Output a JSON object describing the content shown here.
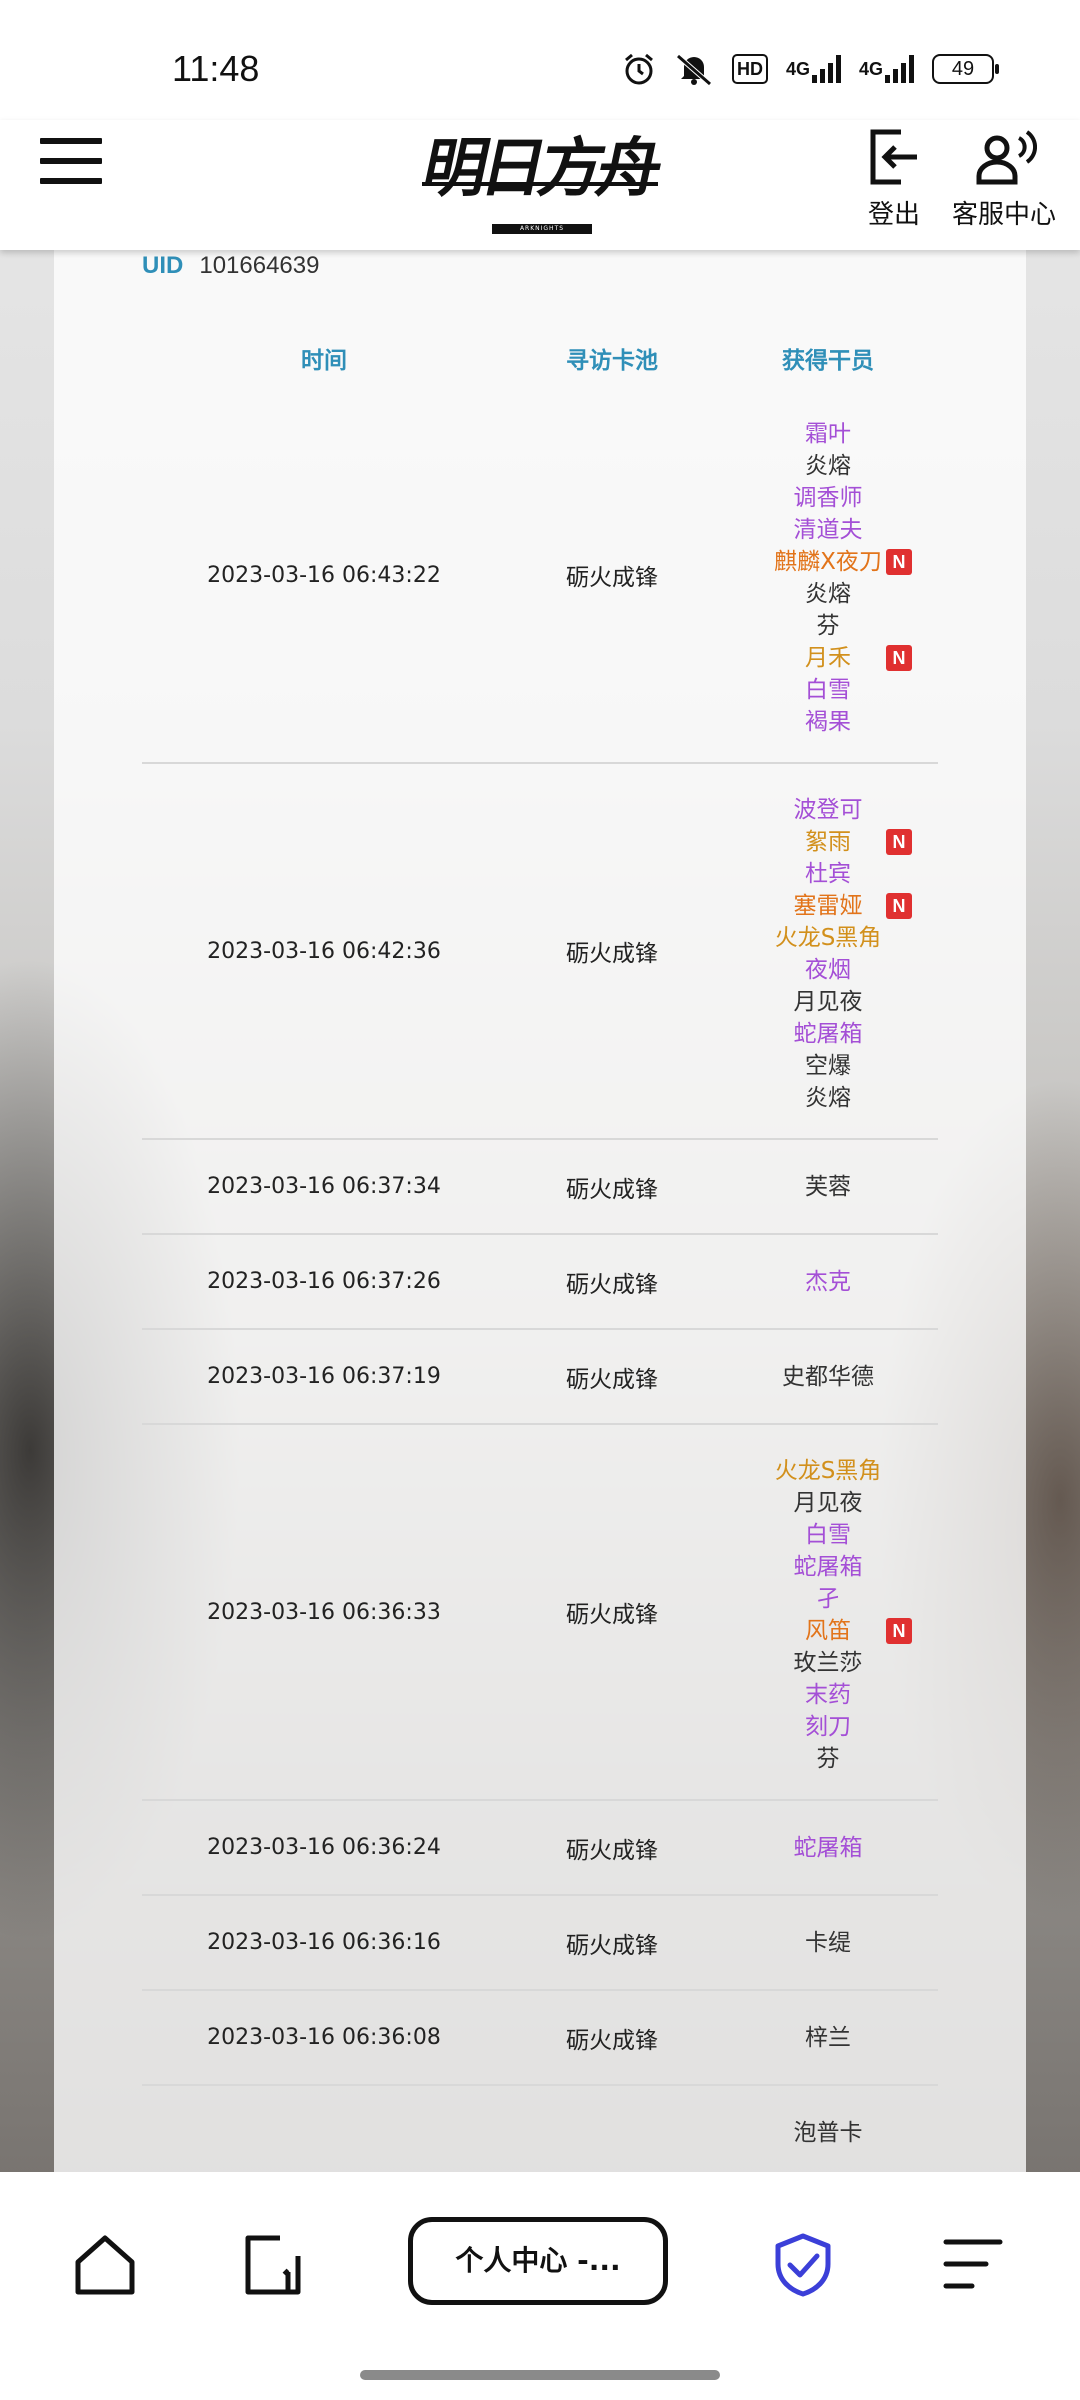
{
  "status": {
    "time": "11:48",
    "hd": "HD",
    "sig1": "4G",
    "sig2": "4G",
    "battery": "49"
  },
  "header": {
    "logo": "明日方舟",
    "logo_sub": "ARKNIGHTS",
    "logout_label": "登出",
    "service_label": "客服中心"
  },
  "uid": {
    "label": "UID",
    "value": "101664639"
  },
  "table": {
    "headers": [
      "时间",
      "寻访卡池",
      "获得干员"
    ],
    "rows": [
      {
        "time": "2023-03-16 06:43:22",
        "pool": "砺火成锋",
        "ops": [
          {
            "name": "霜叶",
            "rarity": 4,
            "new": false
          },
          {
            "name": "炎熔",
            "rarity": 3,
            "new": false
          },
          {
            "name": "调香师",
            "rarity": 4,
            "new": false
          },
          {
            "name": "清道夫",
            "rarity": 4,
            "new": false
          },
          {
            "name": "麒麟X夜刀",
            "rarity": 6,
            "new": true
          },
          {
            "name": "炎熔",
            "rarity": 3,
            "new": false
          },
          {
            "name": "芬",
            "rarity": 3,
            "new": false
          },
          {
            "name": "月禾",
            "rarity": 5,
            "new": true
          },
          {
            "name": "白雪",
            "rarity": 4,
            "new": false
          },
          {
            "name": "褐果",
            "rarity": 4,
            "new": false
          }
        ]
      },
      {
        "time": "2023-03-16 06:42:36",
        "pool": "砺火成锋",
        "ops": [
          {
            "name": "波登可",
            "rarity": 4,
            "new": false
          },
          {
            "name": "絮雨",
            "rarity": 5,
            "new": true
          },
          {
            "name": "杜宾",
            "rarity": 4,
            "new": false
          },
          {
            "name": "塞雷娅",
            "rarity": 6,
            "new": true
          },
          {
            "name": "火龙S黑角",
            "rarity": 5,
            "new": false
          },
          {
            "name": "夜烟",
            "rarity": 4,
            "new": false
          },
          {
            "name": "月见夜",
            "rarity": 3,
            "new": false
          },
          {
            "name": "蛇屠箱",
            "rarity": 4,
            "new": false
          },
          {
            "name": "空爆",
            "rarity": 3,
            "new": false
          },
          {
            "name": "炎熔",
            "rarity": 3,
            "new": false
          }
        ]
      },
      {
        "time": "2023-03-16 06:37:34",
        "pool": "砺火成锋",
        "ops": [
          {
            "name": "芙蓉",
            "rarity": 3,
            "new": false
          }
        ]
      },
      {
        "time": "2023-03-16 06:37:26",
        "pool": "砺火成锋",
        "ops": [
          {
            "name": "杰克",
            "rarity": 4,
            "new": false
          }
        ]
      },
      {
        "time": "2023-03-16 06:37:19",
        "pool": "砺火成锋",
        "ops": [
          {
            "name": "史都华德",
            "rarity": 3,
            "new": false
          }
        ]
      },
      {
        "time": "2023-03-16 06:36:33",
        "pool": "砺火成锋",
        "ops": [
          {
            "name": "火龙S黑角",
            "rarity": 5,
            "new": false
          },
          {
            "name": "月见夜",
            "rarity": 3,
            "new": false
          },
          {
            "name": "白雪",
            "rarity": 4,
            "new": false
          },
          {
            "name": "蛇屠箱",
            "rarity": 4,
            "new": false
          },
          {
            "name": "孑",
            "rarity": 4,
            "new": false
          },
          {
            "name": "风笛",
            "rarity": 6,
            "new": true
          },
          {
            "name": "玫兰莎",
            "rarity": 3,
            "new": false
          },
          {
            "name": "末药",
            "rarity": 4,
            "new": false
          },
          {
            "name": "刻刀",
            "rarity": 4,
            "new": false
          },
          {
            "name": "芬",
            "rarity": 3,
            "new": false
          }
        ]
      },
      {
        "time": "2023-03-16 06:36:24",
        "pool": "砺火成锋",
        "ops": [
          {
            "name": "蛇屠箱",
            "rarity": 4,
            "new": false
          }
        ]
      },
      {
        "time": "2023-03-16 06:36:16",
        "pool": "砺火成锋",
        "ops": [
          {
            "name": "卡缇",
            "rarity": 3,
            "new": false
          }
        ]
      },
      {
        "time": "2023-03-16 06:36:08",
        "pool": "砺火成锋",
        "ops": [
          {
            "name": "梓兰",
            "rarity": 3,
            "new": false
          }
        ]
      },
      {
        "time": "",
        "pool": "",
        "ops": [
          {
            "name": "泡普卡",
            "rarity": 3,
            "new": false
          }
        ]
      }
    ],
    "new_badge": "N"
  },
  "bottom_nav": {
    "tab_label": "个人中心 -...",
    "colors": {
      "shield": "#3b3fd8"
    }
  }
}
